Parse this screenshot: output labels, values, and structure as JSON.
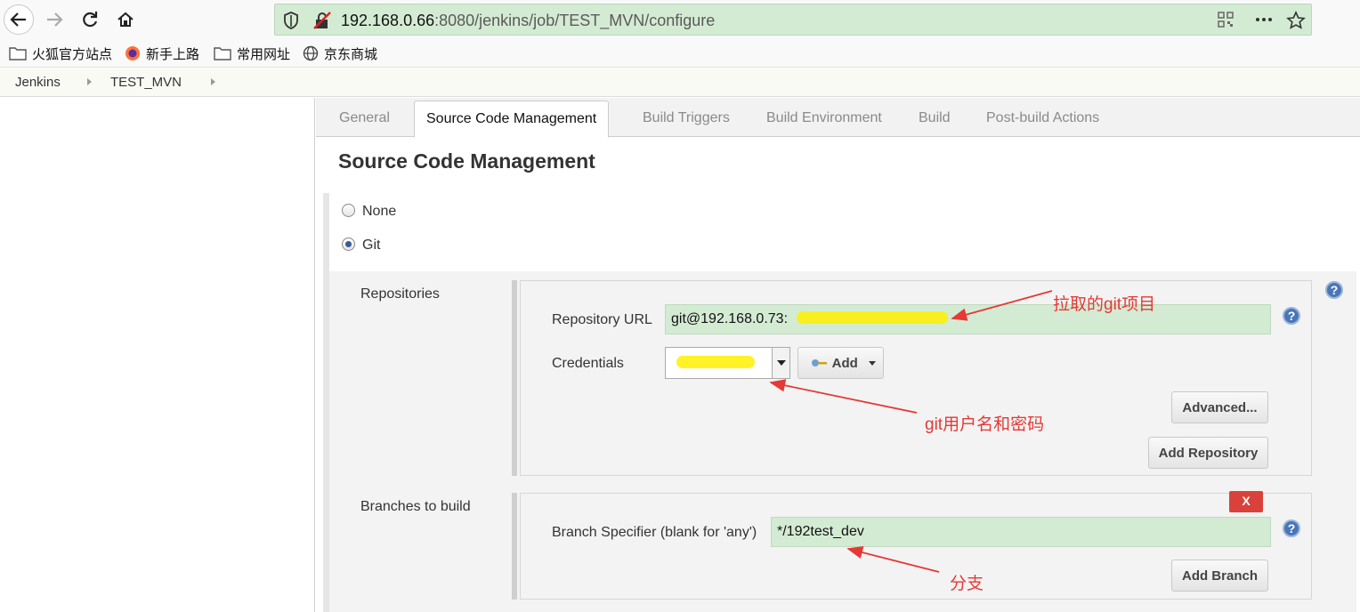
{
  "browser": {
    "url_host": "192.168.0.66",
    "url_rest": ":8080/jenkins/job/TEST_MVN/configure",
    "bookmarks": [
      "火狐官方站点",
      "新手上路",
      "常用网址",
      "京东商城"
    ]
  },
  "breadcrumb": [
    "Jenkins",
    "TEST_MVN"
  ],
  "tabs": [
    "General",
    "Source Code Management",
    "Build Triggers",
    "Build Environment",
    "Build",
    "Post-build Actions"
  ],
  "section_title": "Source Code Management",
  "scm_options": {
    "none_label": "None",
    "git_label": "Git",
    "selected": "Git"
  },
  "repositories": {
    "label": "Repositories",
    "url_label": "Repository URL",
    "url_value": "git@192.168.0.73:",
    "credentials_label": "Credentials",
    "add_label": "Add",
    "advanced_label": "Advanced...",
    "add_repository_label": "Add Repository"
  },
  "branches": {
    "label": "Branches to build",
    "specifier_label": "Branch Specifier (blank for 'any')",
    "specifier_value": "*/192test_dev",
    "delete_label": "X",
    "add_branch_label": "Add Branch"
  },
  "help_glyph": "?",
  "annotations": {
    "repo": "拉取的git项目",
    "credentials": "git用户名和密码",
    "branch": "分支",
    "color": "#e53935"
  }
}
